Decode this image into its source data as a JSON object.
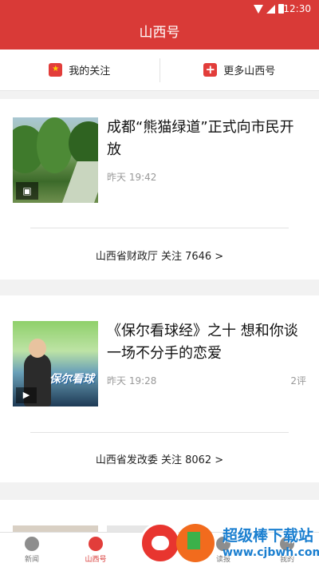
{
  "status_bar": {
    "time": "12:30"
  },
  "header": {
    "title": "山西号"
  },
  "follow_bar": {
    "my_follow": "我的关注",
    "more": "更多山西号"
  },
  "feed": [
    {
      "headline": "成都“熊猫绿道”正式向市民开放",
      "time": "昨天 19:42",
      "comments": "",
      "source": "山西省财政厅  关注 7646 >",
      "thumb_badge_icon": "image-icon"
    },
    {
      "headline": "《保尔看球经》之十   想和你谈一场不分手的恋爱",
      "time": "昨天 19:28",
      "comments": "2评",
      "source": "山西省发改委  关注 8062 >",
      "thumb_badge_icon": "play-icon",
      "thumb_text": "保尔看球"
    }
  ],
  "tabs": [
    {
      "label": "新闻",
      "active": false
    },
    {
      "label": "山西号",
      "active": true
    },
    {
      "label": "",
      "active": false
    },
    {
      "label": "读报",
      "active": false
    },
    {
      "label": "我的",
      "active": false
    }
  ],
  "watermark": {
    "title": "超级棒下载站",
    "url": "www.cjbwh.com"
  },
  "colors": {
    "brand_red": "#d93a37",
    "meta_gray": "#999999"
  }
}
